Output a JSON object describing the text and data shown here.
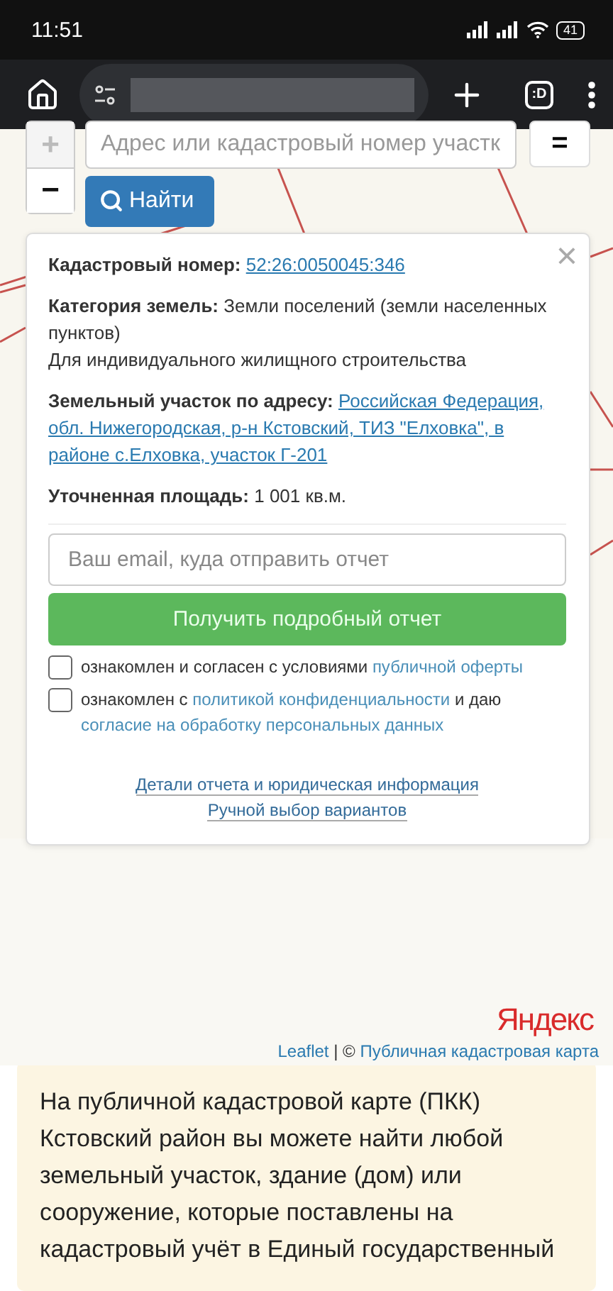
{
  "status_bar": {
    "time": "11:51",
    "battery": "41"
  },
  "browser": {
    "tab_count": ":D"
  },
  "map": {
    "search": {
      "placeholder": "Адрес или кадастровый номер участк"
    },
    "zoom_in": "+",
    "zoom_out": "−",
    "menu": "=",
    "find_button": "Найти",
    "popup": {
      "close": "×",
      "fields": [
        {
          "label": "Кадастровый номер:",
          "value": "52:26:0050045:346",
          "kind": "link"
        },
        {
          "label": "Категория земель:",
          "value": "Земли поселений (земли населенных пунктов)",
          "kind": "text",
          "note": "Для индивидуального жилищного строительства"
        },
        {
          "label": "Земельный участок по адресу:",
          "value_lines": [
            "Российская Федерация,",
            "обл. Нижегородская, р-н Кстовский, ТИЗ \"Елховка\", в",
            "районе с.Елховка, участок Г-201"
          ],
          "kind": "link"
        },
        {
          "label": "Уточненная площадь:",
          "value": "1 001 кв.м.",
          "kind": "text"
        }
      ],
      "email": {
        "placeholder": "Ваш email, куда отправить отчет"
      },
      "submit": "Получить подробный отчет",
      "agreements": [
        {
          "checked": false,
          "parts": [
            {
              "text": "ознакомлен и согласен с условиями ",
              "kind": "text"
            },
            {
              "text": "публичной оферты",
              "kind": "link"
            }
          ]
        },
        {
          "checked": false,
          "parts": [
            {
              "text": "ознакомлен с ",
              "kind": "text"
            },
            {
              "text": "политикой конфиденциальности",
              "kind": "link"
            },
            {
              "text": " и даю ",
              "kind": "text"
            },
            {
              "text": "согласие на обработку персональных данных",
              "kind": "link"
            }
          ]
        }
      ],
      "links": [
        "Детали отчета и юридическая информация",
        "Ручной выбор вариантов"
      ]
    },
    "provider_logo": "Яндекс",
    "attribution": [
      {
        "text": "Leaflet",
        "kind": "link"
      },
      {
        "text": " | © ",
        "kind": "text"
      },
      {
        "text": "Публичная кадастровая карта",
        "kind": "link"
      }
    ]
  },
  "info": {
    "text": "На публичной кадастровой карте (ПКК) Кстовский район вы можете найти любой земельный участок, здание (дом) или сооружение, которые поставлены на кадастровый учёт в Единый государственный"
  }
}
